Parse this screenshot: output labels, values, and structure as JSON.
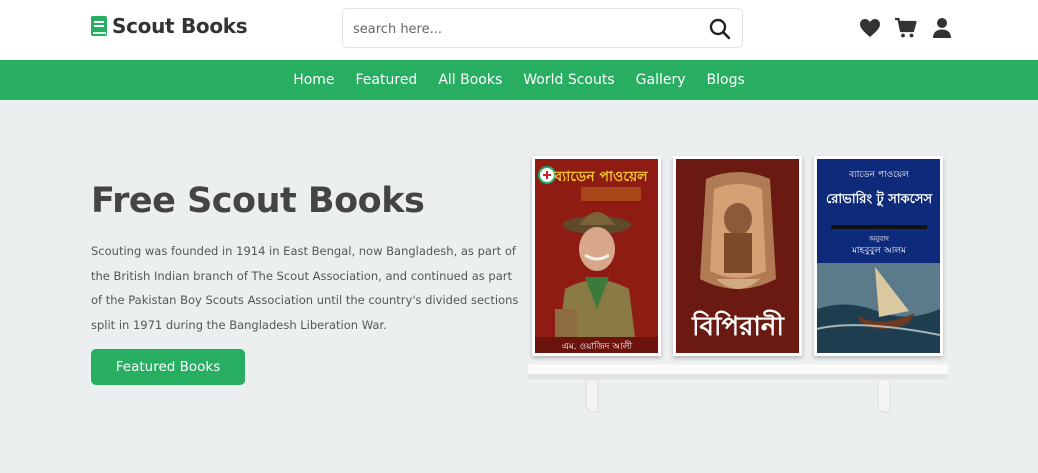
{
  "header": {
    "logo_text": "Scout Books",
    "search_placeholder": "search here...",
    "brand_color": "#27ae60"
  },
  "icons": [
    "book-icon",
    "search-icon",
    "heart-icon",
    "cart-icon",
    "user-icon"
  ],
  "nav": {
    "items": [
      "Home",
      "Featured",
      "All Books",
      "World Scouts",
      "Gallery",
      "Blogs"
    ]
  },
  "hero": {
    "title": "Free Scout Books",
    "description": "Scouting was founded in 1914 in East Bengal, now Bangladesh, as part of the British Indian branch of The Scout Association, and continued as part of the Pakistan Boy Scouts Association until the country's divided sections split in 1971 during the Bangladesh Liberation War.",
    "button_label": "Featured Books"
  },
  "books": [
    {
      "title": "ব্যাডেন পাওয়েল",
      "author": "এম. ওয়াজিদ আলী"
    },
    {
      "title": "বিপিরানী"
    },
    {
      "title": "রোভারিং টু সাকসেস",
      "top_line": "ব্যাডেন পাওয়েল",
      "translator_label": "অনুবাদ",
      "translator": "মাহবুবুল আলম"
    }
  ]
}
